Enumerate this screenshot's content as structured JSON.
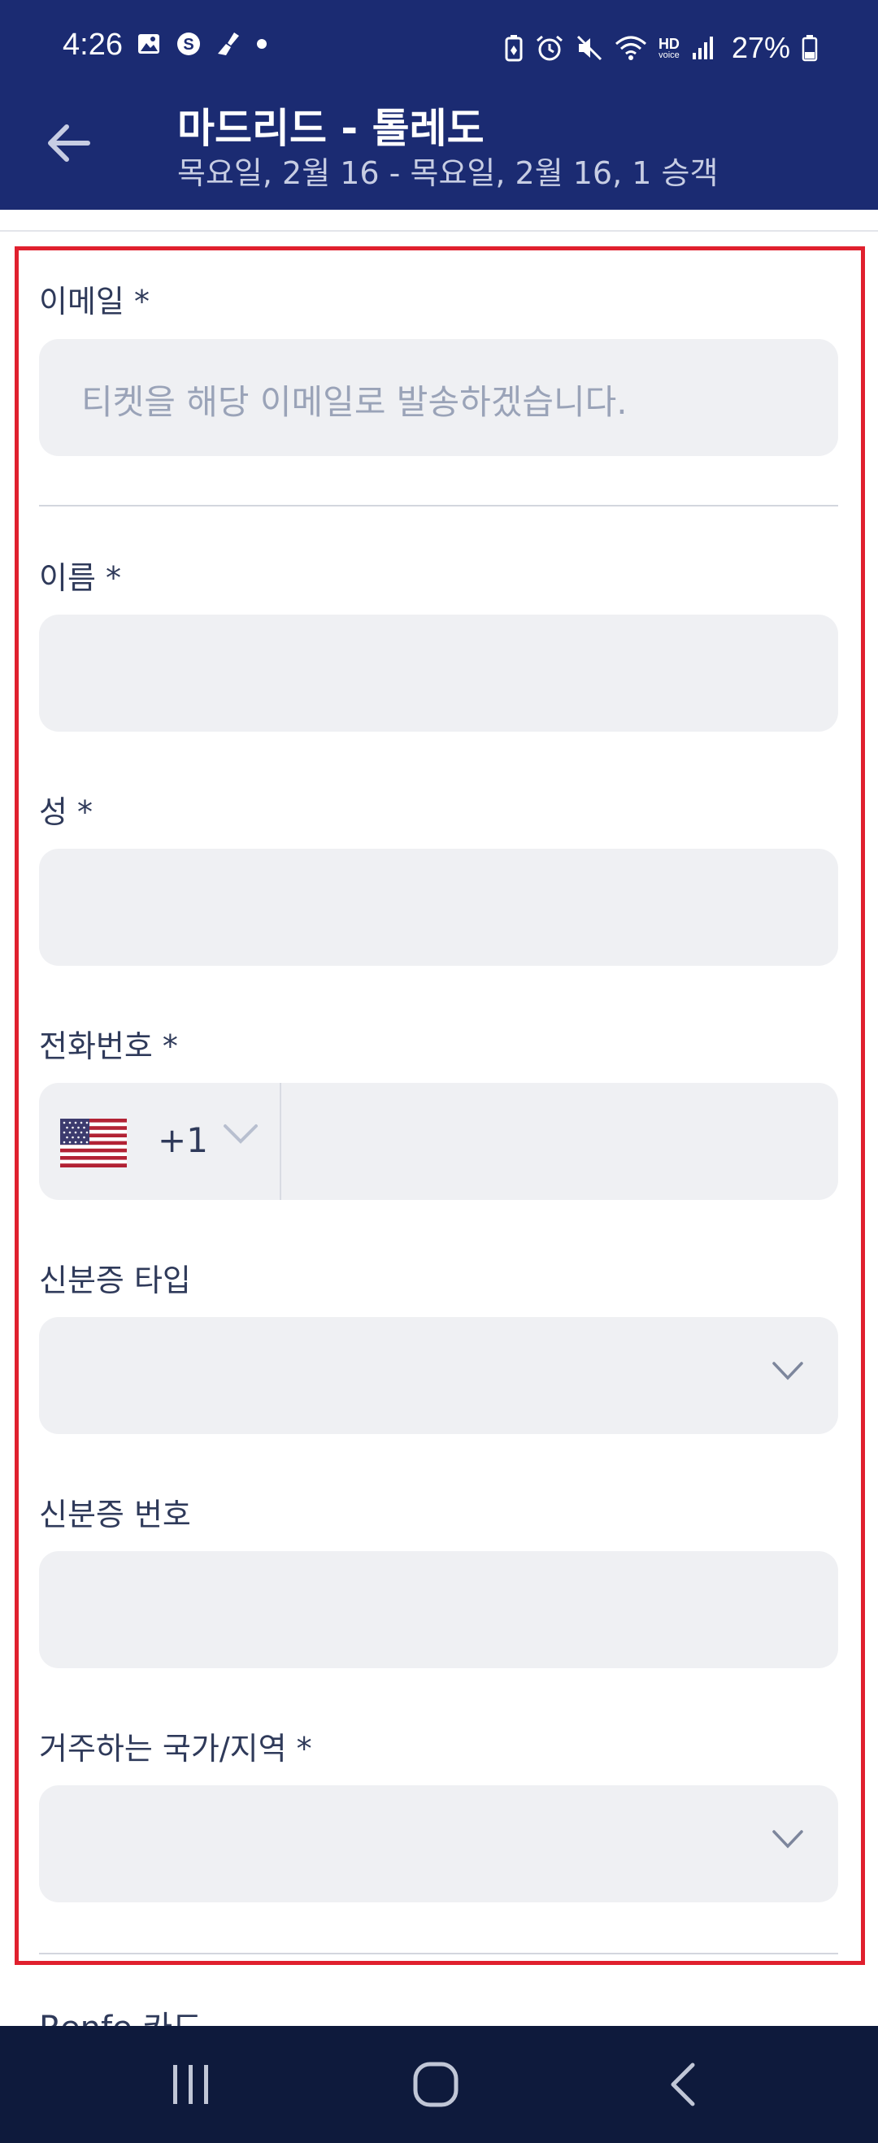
{
  "status_bar": {
    "time": "4:26",
    "battery_percent": "27%",
    "left_icons": [
      "gallery-icon",
      "s-app-icon",
      "broom-icon",
      "notification-dot"
    ],
    "right_icons": [
      "battery-saver-icon",
      "alarm-icon",
      "mute-icon",
      "wifi-icon",
      "hd-voice-icon",
      "signal-icon",
      "battery-icon"
    ],
    "hd_label": "HD",
    "voice_label": "voice"
  },
  "header": {
    "title": "마드리드 - 톨레도",
    "subtitle": "목요일, 2월 16 - 목요일, 2월 16, 1 승객",
    "background_color": "#1b2b72"
  },
  "form": {
    "email": {
      "label": "이메일 *",
      "value": "",
      "placeholder": "티켓을 해당 이메일로 발송하겠습니다."
    },
    "first_name": {
      "label": "이름 *",
      "value": ""
    },
    "last_name": {
      "label": "성 *",
      "value": ""
    },
    "phone": {
      "label": "전화번호 *",
      "country_flag": "us-flag-icon",
      "dial_code": "+1",
      "value": ""
    },
    "id_type": {
      "label": "신분증 타입",
      "value": ""
    },
    "id_number": {
      "label": "신분증 번호",
      "value": ""
    },
    "country": {
      "label": "거주하는 국가/지역 *",
      "value": ""
    }
  },
  "next_section": {
    "label": "Renfe 카드"
  },
  "highlight_color": "#e0202e",
  "nav_bar": {
    "buttons": [
      "recent-apps-icon",
      "home-icon",
      "back-icon"
    ]
  }
}
